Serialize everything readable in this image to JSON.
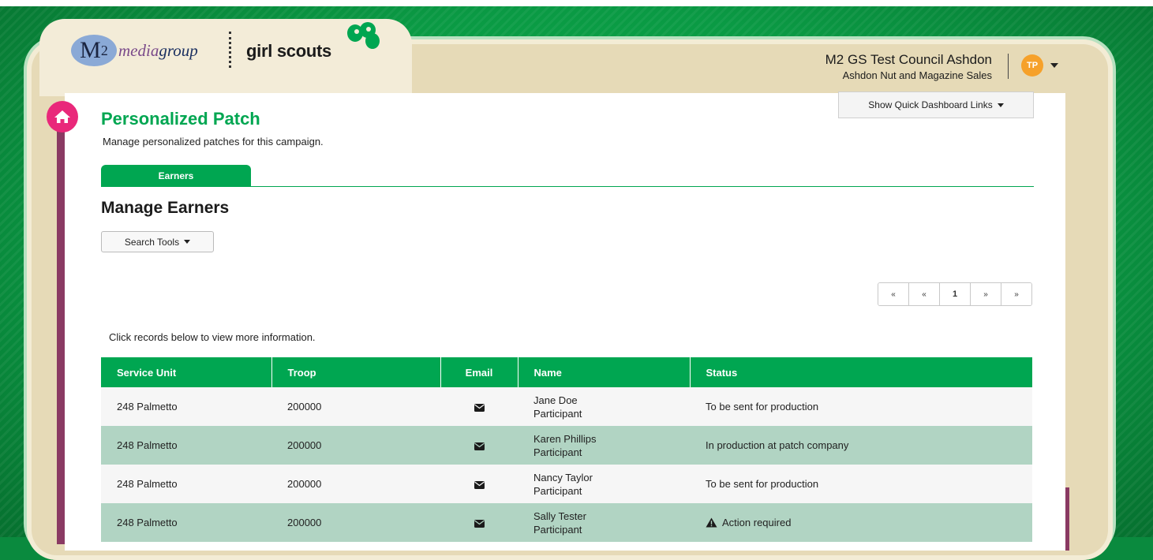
{
  "brand": {
    "m2_text": "M",
    "m2_sub": "2",
    "media_text_a": "media",
    "media_text_b": "group",
    "gs_text": "girl scouts"
  },
  "account": {
    "council": "M2 GS Test Council Ashdon",
    "campaign": "Ashdon Nut and Magazine Sales",
    "initials": "TP"
  },
  "quick_links_label": "Show Quick Dashboard Links",
  "page": {
    "title": "Personalized Patch",
    "subtitle": "Manage personalized patches for this campaign."
  },
  "tabs": [
    {
      "label": "Earners"
    }
  ],
  "section_title": "Manage Earners",
  "search_tools_label": "Search Tools",
  "pager": [
    "«",
    "«",
    "1",
    "»",
    "»"
  ],
  "hint": "Click records below to view more information.",
  "table": {
    "headers": [
      "Service Unit",
      "Troop",
      "Email",
      "Name",
      "Status"
    ],
    "rows": [
      {
        "service_unit": "248 Palmetto",
        "troop": "200000",
        "name": "Jane Doe",
        "role": "Participant",
        "status": "To be sent for production"
      },
      {
        "service_unit": "248 Palmetto",
        "troop": "200000",
        "name": "Karen Phillips",
        "role": "Participant",
        "status": "In production at patch company"
      },
      {
        "service_unit": "248 Palmetto",
        "troop": "200000",
        "name": "Nancy Taylor",
        "role": "Participant",
        "status": "To be sent for production"
      },
      {
        "service_unit": "248 Palmetto",
        "troop": "200000",
        "name": "Sally Tester",
        "role": "Participant",
        "status": "Action required"
      }
    ]
  },
  "colors": {
    "brand_green": "#00a651",
    "home_pink": "#e9287a",
    "avatar_orange": "#f6a12a",
    "row_alt": "#b1d4c3"
  }
}
